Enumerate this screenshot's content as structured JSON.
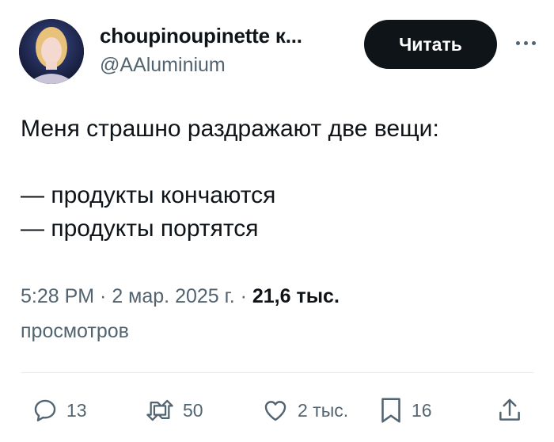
{
  "author": {
    "display_name": "choupinoupinette к...",
    "handle": "@AAluminium"
  },
  "follow_button": "Читать",
  "more_icon": "more-horizontal-icon",
  "tweet": {
    "lines": [
      "Меня страшно раздражают две вещи:",
      "",
      "— продукты кончаются",
      "— продукты портятся"
    ]
  },
  "meta": {
    "time": "5:28 PM",
    "sep1": " · ",
    "date": "2 мар. 2025 г.",
    "sep2": " · ",
    "views_count": "21,6 тыс.",
    "views_label": "просмотров"
  },
  "actions": {
    "replies": "13",
    "retweets": "50",
    "likes": "2 тыс.",
    "bookmarks": "16"
  },
  "colors": {
    "text": "#0f1419",
    "secondary": "#536471",
    "button_bg": "#0f1419"
  }
}
